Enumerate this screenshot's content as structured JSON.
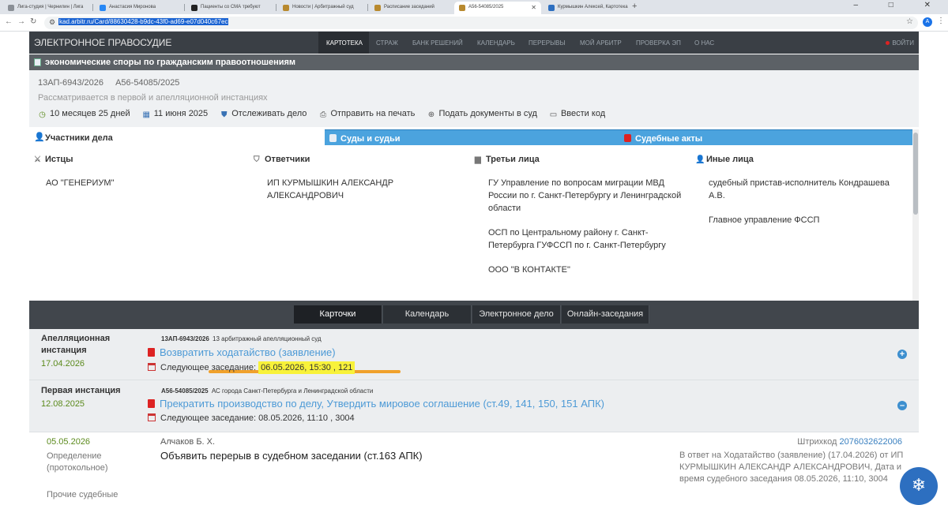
{
  "browser": {
    "tabs": [
      {
        "label": "Лига-студия | Чернилин | Лига"
      },
      {
        "label": "Анастасия Миронова"
      },
      {
        "label": "Пациенты со СМА требуют"
      },
      {
        "label": "Новости | Арбитражный суд"
      },
      {
        "label": "Расписание заседаний"
      },
      {
        "label": "А56-54085/2025"
      },
      {
        "label": "Курмышкин Алексей, Картотека"
      }
    ],
    "new_tab": "+",
    "window_controls": "– □ ✕",
    "url": "kad.arbitr.ru/Card/88630428-b9dc-43f0-ad69-e07d040c67ec",
    "profile_initial": "A"
  },
  "site_nav": {
    "brand": "ЭЛЕКТРОННОЕ ПРАВОСУДИЕ",
    "items": [
      "КАРТОТЕКА",
      "СТРАЖ",
      "БАНК РЕШЕНИЙ",
      "КАЛЕНДАРЬ",
      "ПЕРЕРЫВЫ",
      "МОЙ АРБИТР",
      "ПРОВЕРКА ЭП",
      "О НАС"
    ],
    "exit": "ВОЙТИ"
  },
  "case": {
    "dispute_type": "экономические споры по гражданским правоотношениям",
    "number_appeal": "13АП-6943/2026",
    "number_first": "А56-54085/2025",
    "status": "Рассматривается в первой и апелляционной инстанциях",
    "duration": "10 месяцев 25 дней",
    "date": "11 июня 2025",
    "track": "Отслеживать дело",
    "print": "Отправить на печать",
    "submit": "Подать документы в суд",
    "code": "Ввести код"
  },
  "section_tabs": [
    "Участники дела",
    "Суды и судьи",
    "Судебные акты"
  ],
  "participants": {
    "plaintiffs": {
      "title": "Истцы",
      "items": [
        "АО \"ГЕНЕРИУМ\""
      ]
    },
    "defendants": {
      "title": "Ответчики",
      "items": [
        "ИП КУРМЫШКИН АЛЕКСАНДР АЛЕКСАНДРОВИЧ"
      ]
    },
    "third": {
      "title": "Третьи лица",
      "items": [
        "ГУ Управление по вопросам миграции МВД России по г. Санкт-Петербургу и Ленинградской области",
        "ОСП по Центральному району г. Санкт-Петербурга ГУФССП по г. Санкт-Петербургу",
        "ООО \"В КОНТАКТЕ\""
      ]
    },
    "others": {
      "title": "Иные лица",
      "items": [
        "судебный пристав-исполнитель Кондрашева А.В.",
        "Главное управление ФССП"
      ]
    }
  },
  "bottom_tabs": [
    "Карточки",
    "Календарь",
    "Электронное дело",
    "Онлайн-заседания"
  ],
  "instances": {
    "appeal": {
      "name": "Апелляционная инстанция",
      "date": "17.04.2026",
      "case_no": "13АП-6943/2026",
      "court": "13 арбитражный апелляционный суд",
      "doc": "Возвратить ходатайство (заявление)",
      "next_label": "Следующее заседание:",
      "next_value": "06.05.2026, 15:30 , 121",
      "toggle": "+"
    },
    "first": {
      "name": "Первая инстанция",
      "date": "12.08.2025",
      "case_no": "А56-54085/2025",
      "court": "АС города Санкт-Петербурга и Ленинградской области",
      "doc": "Прекратить производство по делу, Утвердить мировое соглашение (ст.49, 141, 150, 151 АПК)",
      "next_label": "Следующее заседание:",
      "next_value": "08.05.2026, 11:10 , 3004",
      "toggle": "–"
    }
  },
  "detail": {
    "date": "05.05.2026",
    "type": "Определение (протокольное)",
    "judge": "Алчаков Б. Х.",
    "title": "Объявить перерыв в судебном заседании (ст.163 АПК)",
    "barcode_label": "Штрихкод",
    "barcode_value": "2076032622006",
    "answer": "В ответ на Ходатайство (заявление) (17.04.2026) от ИП КУРМЫШКИН АЛЕКСАНДР АЛЕКСАНДРОВИЧ, Дата и время судебного заседания 08.05.2026, 11:10, 3004",
    "more": "Прочие судебные"
  }
}
